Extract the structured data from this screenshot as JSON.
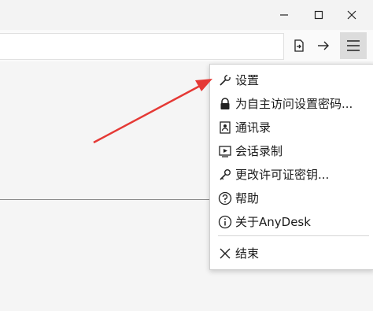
{
  "window": {
    "minimize_icon": "minimize-icon",
    "maximize_icon": "maximize-icon",
    "close_icon": "close-icon"
  },
  "toolbar": {
    "icons": [
      "file-transfer-icon",
      "connect-arrow-icon",
      "hamburger-menu-icon"
    ]
  },
  "menu": {
    "items": [
      {
        "label": "设置",
        "icon": "wrench-icon"
      },
      {
        "label": "为自主访问设置密码...",
        "icon": "lock-icon"
      },
      {
        "label": "通讯录",
        "icon": "address-book-icon"
      },
      {
        "label": "会话录制",
        "icon": "recording-icon"
      },
      {
        "label": "更改许可证密钥...",
        "icon": "key-icon"
      },
      {
        "label": "帮助",
        "icon": "help-icon"
      },
      {
        "label": "关于AnyDesk",
        "icon": "info-icon"
      },
      {
        "label": "结束",
        "icon": "exit-x-icon"
      }
    ]
  },
  "annotation": {
    "arrow_color": "#e53935"
  }
}
